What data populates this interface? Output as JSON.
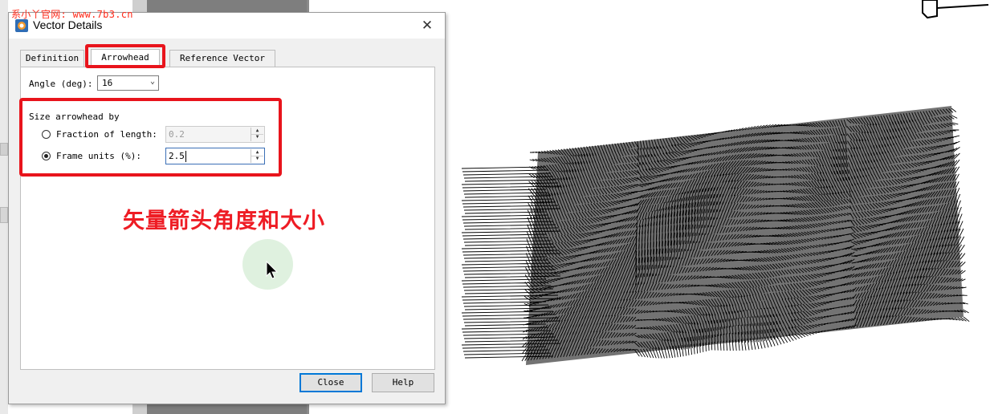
{
  "watermark": "系小丫官网: www.7b3.cn",
  "dialog": {
    "title": "Vector Details",
    "close_glyph": "✕",
    "icon": "app-logo-icon"
  },
  "tabs": [
    {
      "label": "Definition",
      "active": false
    },
    {
      "label": "Arrowhead",
      "active": true
    },
    {
      "label": "Reference Vector",
      "active": false
    }
  ],
  "angle": {
    "label": "Angle (deg):",
    "value": "16",
    "chevron": "⌄"
  },
  "size": {
    "group_label": "Size arrowhead by",
    "fraction": {
      "label": "Fraction of length:",
      "value": "0.2",
      "checked": false,
      "enabled": false
    },
    "frame": {
      "label": "Frame units (%):",
      "value": "2.5",
      "checked": true,
      "enabled": true
    }
  },
  "annotation": {
    "caption": "矢量箭头角度和大小",
    "highlight_color": "#e8141c"
  },
  "buttons": {
    "close": "Close",
    "help": "Help"
  },
  "colors": {
    "accent_focus": "#0078d7",
    "annotation_red": "#e8141c",
    "vector_color": "#000000"
  }
}
